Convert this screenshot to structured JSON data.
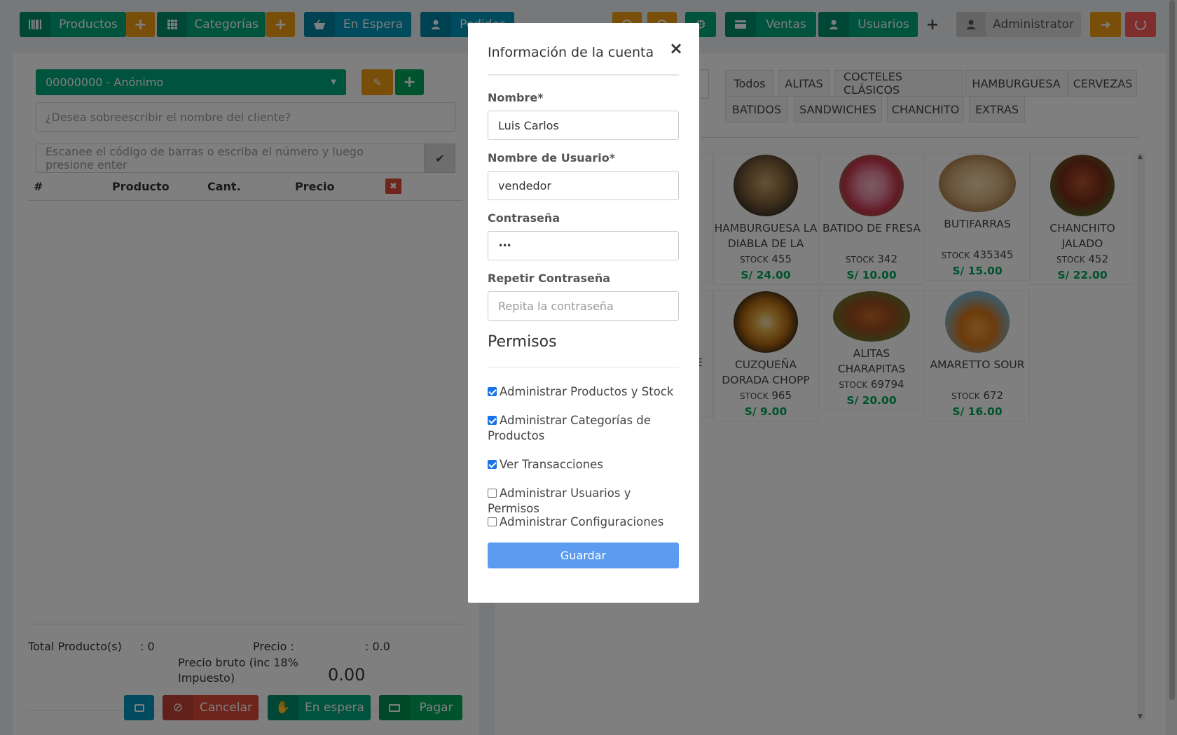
{
  "topbar": {
    "productos": "Productos",
    "categorias": "Categorías",
    "en_espera": "En Espera",
    "pedidos": "Pedidos",
    "ventas": "Ventas",
    "usuarios": "Usuarios",
    "plus": "+",
    "user": "Administrator"
  },
  "left": {
    "customer_select": "00000000 - Anónimo",
    "customer_override_placeholder": "¿Desea sobreescribir el nombre del cliente?",
    "barcode_placeholder": "Escanee el código de barras o escriba el número y luego presione enter",
    "table_headers": [
      "#",
      "Producto",
      "Cant.",
      "Precio"
    ],
    "total_products_label": "Total Producto(s)",
    "total_products_value": ": 0",
    "price_label": "Precio :",
    "price_value": ": 0.0",
    "gross_label": "Precio bruto (inc 18% Impuesto)",
    "gross_value": "0.00",
    "buttons": {
      "cancel": "Cancelar",
      "hold": "En espera",
      "pay": "Pagar"
    }
  },
  "categories": [
    "Todos",
    "ALITAS",
    "COCTELES CLÁSICOS",
    "HAMBURGUESA",
    "CERVEZAS",
    "BATIDOS",
    "SANDWICHES",
    "CHANCHITO",
    "EXTRAS"
  ],
  "products": [
    {
      "name": "HAMBURGUESA LA DIABLA DE LA",
      "stock_label": "STOCK",
      "stock": "455",
      "price": "S/ 24.00"
    },
    {
      "name": "BATIDO DE FRESA",
      "stock_label": "STOCK",
      "stock": "342",
      "price": "S/ 10.00"
    },
    {
      "name": "BUTIFARRAS",
      "stock_label": "STOCK",
      "stock": "435345",
      "price": "S/ 15.00"
    },
    {
      "name": "CHANCHITO JALADO",
      "stock_label": "STOCK",
      "stock": "452",
      "price": "S/ 22.00"
    },
    {
      "name": "CUZQUEÑA DORADA CHOPP",
      "stock_label": "STOCK",
      "stock": "965",
      "price": "S/ 9.00"
    },
    {
      "name": "ALITAS CHARAPITAS",
      "stock_label": "STOCK",
      "stock": "69794",
      "price": "S/ 20.00"
    },
    {
      "name": "AMARETTO SOUR",
      "stock_label": "STOCK",
      "stock": "672",
      "price": "S/ 16.00"
    }
  ],
  "partial_card_text": "E",
  "modal": {
    "title": "Información de la cuenta",
    "close": "×",
    "nombre_label": "Nombre*",
    "nombre_value": "Luis Carlos",
    "usuario_label": "Nombre de Usuario*",
    "usuario_value": "vendedor",
    "pass_label": "Contraseña",
    "pass_value": "•••",
    "repeat_label": "Repetir Contraseña",
    "repeat_placeholder": "Repita la contraseña",
    "permisos_title": "Permisos",
    "permissions": [
      {
        "label": "Administrar Productos y Stock",
        "checked": true
      },
      {
        "label": "Administrar Categorías de Productos",
        "checked": true
      },
      {
        "label": "Ver Transacciones",
        "checked": true
      },
      {
        "label": "Administrar Usuarios y Permisos",
        "checked": false
      },
      {
        "label": "Administrar Configuraciones",
        "checked": false
      }
    ],
    "save": "Guardar"
  },
  "colors": {
    "teal": "#00a679",
    "blue": "#0097bc",
    "amber": "#f39c12",
    "red": "#dd4b39",
    "green": "#00a65a",
    "save": "#5b9cf0"
  }
}
